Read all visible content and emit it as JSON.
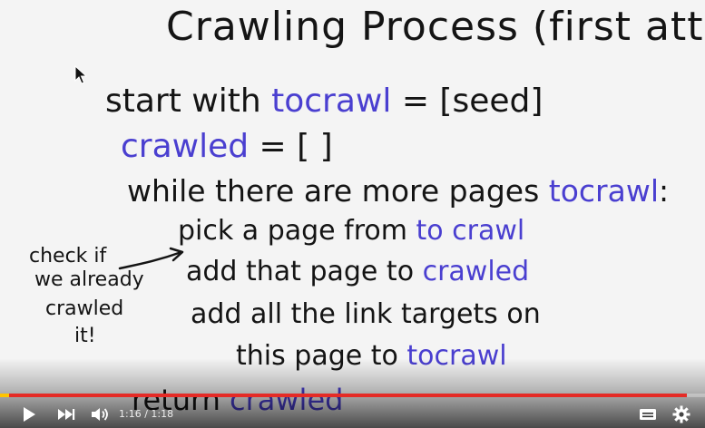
{
  "slide": {
    "title": "Crawling Process (first attempt)",
    "lines": [
      [
        {
          "text": "start with ",
          "color": "dark"
        },
        {
          "text": "tocrawl",
          "color": "blue"
        },
        {
          "text": " = [seed]",
          "color": "dark"
        }
      ],
      [
        {
          "text": "crawled",
          "color": "blue"
        },
        {
          "text": " = [ ]",
          "color": "dark"
        }
      ],
      [
        {
          "text": "while there are more pages ",
          "color": "dark"
        },
        {
          "text": "tocrawl",
          "color": "blue"
        },
        {
          "text": ":",
          "color": "dark"
        }
      ],
      [
        {
          "text": "pick a page from ",
          "color": "dark"
        },
        {
          "text": "to crawl",
          "color": "blue"
        }
      ],
      [
        {
          "text": "add that page to ",
          "color": "dark"
        },
        {
          "text": "crawled",
          "color": "blue"
        }
      ],
      [
        {
          "text": "add all the link targets on",
          "color": "dark"
        }
      ],
      [
        {
          "text": "this page to ",
          "color": "dark"
        },
        {
          "text": "tocrawl",
          "color": "blue"
        }
      ],
      [
        {
          "text": "return ",
          "color": "dark"
        },
        {
          "text": "crawled",
          "color": "blue"
        }
      ]
    ],
    "side_note": [
      "check if",
      "we already",
      "crawled",
      "it!"
    ]
  },
  "player": {
    "time_display": "1:16 / 1:18",
    "progress_fraction": 0.974,
    "icons": {
      "play": "play-icon",
      "next": "next-icon",
      "volume": "volume-icon",
      "subtitles": "subtitles-icon",
      "settings": "gear-icon"
    }
  },
  "colors": {
    "ink_dark": "#141414",
    "ink_blue": "#4a3fd0",
    "board": "#f4f4f4",
    "progress_red": "#e52b26",
    "buffer_yellow": "#ffc400"
  }
}
